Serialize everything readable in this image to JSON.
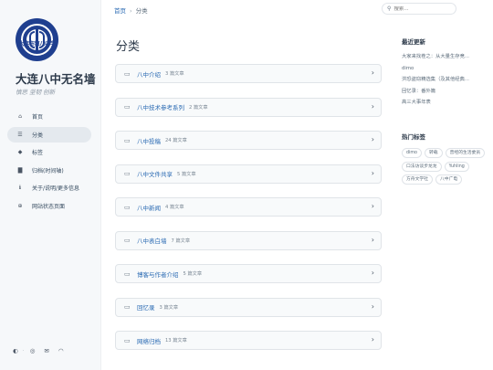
{
  "site": {
    "title": "大连八中无名墙",
    "subtitle": "慎思 坚韧 创新",
    "logo_text": "大连市第八中学",
    "brand_color": "#1f3f8f"
  },
  "nav": [
    {
      "icon": "home-icon",
      "glyph": "⌂",
      "label": "首页",
      "active": false
    },
    {
      "icon": "stream-icon",
      "glyph": "☰",
      "label": "分类",
      "active": true
    },
    {
      "icon": "tag-icon",
      "glyph": "◆",
      "label": "标签",
      "active": false
    },
    {
      "icon": "archive-icon",
      "glyph": "▇",
      "label": "归档(时间轴)",
      "active": false
    },
    {
      "icon": "info-icon",
      "glyph": "ℹ",
      "label": "关于/说明/更多信息",
      "active": false
    },
    {
      "icon": "globe-icon",
      "glyph": "⊕",
      "label": "网站状态页面",
      "active": false
    }
  ],
  "footer": {
    "theme_glyph": "◐",
    "sep": "·",
    "github_glyph": "◎",
    "mail_glyph": "✉",
    "rss_glyph": "◠"
  },
  "breadcrumb": {
    "home": "首页",
    "sep": "›",
    "current": "分类"
  },
  "search": {
    "placeholder": "搜索...",
    "icon_glyph": "⚲"
  },
  "page": {
    "title": "分类"
  },
  "categories": [
    {
      "name": "八中介绍",
      "count": "3 篇文章"
    },
    {
      "name": "八中技术参考系列",
      "count": "2 篇文章"
    },
    {
      "name": "八中投稿",
      "count": "24 篇文章"
    },
    {
      "name": "八中文件共享",
      "count": "5 篇文章"
    },
    {
      "name": "八中新闻",
      "count": "4 篇文章"
    },
    {
      "name": "八中表白墙",
      "count": "7 篇文章"
    },
    {
      "name": "博客与作者介绍",
      "count": "5 篇文章"
    },
    {
      "name": "回忆录",
      "count": "3 篇文章"
    },
    {
      "name": "网络归档",
      "count": "13 篇文章"
    }
  ],
  "card_glyphs": {
    "folder": "▭",
    "chevron": "›"
  },
  "recent": {
    "title": "最近更新",
    "items": [
      "大家来找茬之：从大量生存竞...",
      "dimo",
      "洪恐盗窃精选集（及其他经典...",
      "回忆录：番外篇",
      "高三大事年表"
    ]
  },
  "hot_tags": {
    "title": "热门标签",
    "items": [
      "dimo",
      "转载",
      "曾经的生活委员",
      "口法访谈步龙龙",
      "Yuhling",
      "方舟文学社",
      "八中广电"
    ]
  }
}
